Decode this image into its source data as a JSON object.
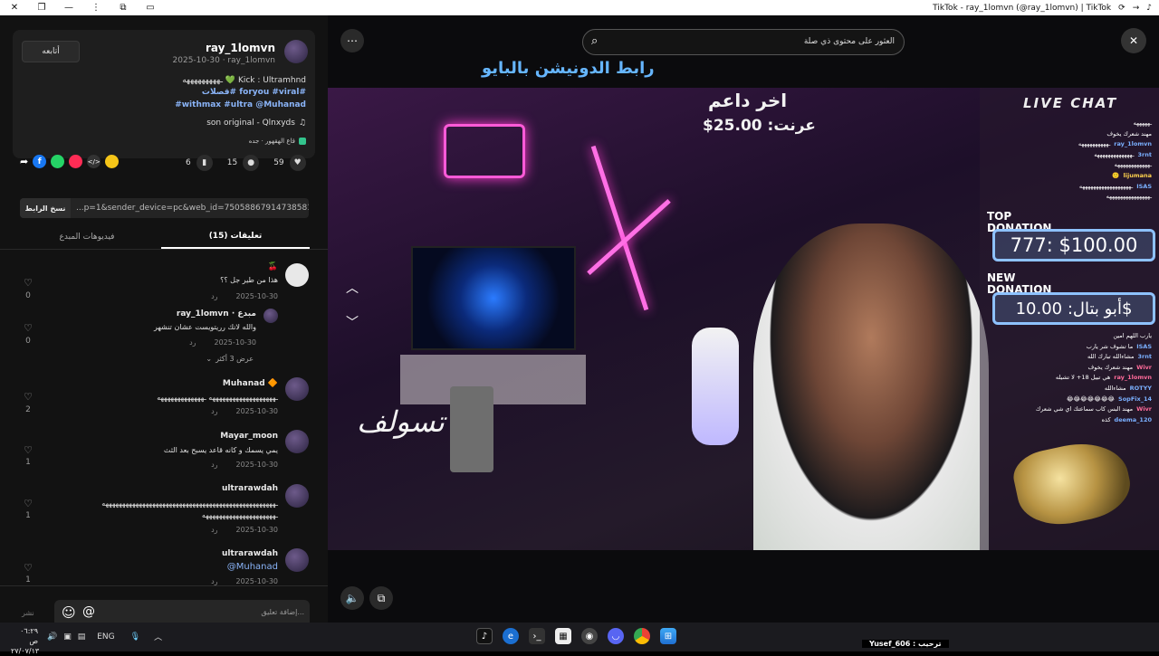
{
  "window": {
    "title": "TikTok - ray_1lomvn (@ray_1lomvn) | TikTok"
  },
  "post": {
    "username": "ray_1lomvn",
    "meta": "2025-10-30 · ray_1lomvn",
    "follow_label": "أتابعه",
    "caption_line1": "Kick : Ultramhnd 💚 ـهههههههههه",
    "hashtags_line1": "#foryou #viral #قصلات",
    "hashtags_line2": "#withmax #ultra @Muhanad",
    "music": "son original - Qlnxyds",
    "tag_text": "قاع الهقهور · جده",
    "likes": "59",
    "comments": "15",
    "saves": "6",
    "link_value": "...p=1&sender_device=pc&web_id=7505886791473858103",
    "copy_label": "نسخ الرابط"
  },
  "tabs": {
    "comments": "(15) تعليقات",
    "creator_videos": "فيديوهات المبدع"
  },
  "comments": [
    {
      "name": "🍒",
      "text": "هذا من طير جل ؟؟",
      "date": "2025-10-30",
      "reply": "رد",
      "likes": "0"
    },
    {
      "name": "ray_1lomvn · مبدع",
      "text": "والله لانك رريتويست عشان تنشهر",
      "date": "2025-10-30",
      "reply": "رد",
      "likes": "0",
      "more": "عرض 3 أكثر"
    },
    {
      "name": "Muhanad 🔶",
      "text": "ـهههههههههههههههههههه ـهههههههههههههه",
      "date": "2025-10-30",
      "reply": "رد",
      "likes": "2"
    },
    {
      "name": "Mayar_moon",
      "text": "يمي يسمك و كانه قاعد يسبح بعد الثث",
      "date": "2025-10-30",
      "reply": "رد",
      "likes": "1"
    },
    {
      "name": "ultrarawdah",
      "text": "ـهههههههههههههههههههههههههههههههههههههههههههههههههههه",
      "text2": "ـهههههههههههههههههههههه",
      "date": "2025-10-30",
      "reply": "رد",
      "likes": "1"
    },
    {
      "name": "ultrarawdah",
      "text": "@Muhanad",
      "date": "2025-10-30",
      "reply": "رد",
      "likes": "1"
    }
  ],
  "composer": {
    "placeholder": "إضافة تعليق...",
    "post_label": "نشر"
  },
  "search": {
    "placeholder": "العثور على محتوى ذي صلة"
  },
  "overlay": {
    "banner": "رابط الدونيشن بالبايو",
    "last_supporter_title": "اخر داعم",
    "last_supporter_amount": "عرنت: 25.00$",
    "live_chat": "LIVE CHAT",
    "top_donation_label": "TOP DONATION",
    "top_donation_value": "777: $100.00",
    "new_donation_label": "NEW DONATION",
    "new_donation_value": "أبو بتال: 10.00$",
    "signature": "تسولف"
  },
  "chat": [
    {
      "user": "",
      "msg": "ـهههههه"
    },
    {
      "user": "",
      "msg": "مهند شعرك يخوف"
    },
    {
      "user": "ray_1lomvn",
      "msg": "ـههههههههههه"
    },
    {
      "user": "3rnt",
      "msg": "ـهههههههههههههه"
    },
    {
      "user": "",
      "msg": "ـههههههههههههه"
    },
    {
      "user": "lijumana",
      "msg": "🙂"
    },
    {
      "user": "ISAS",
      "msg": "ـههههههههههههههههههه"
    },
    {
      "user": "",
      "msg": "ـهههههههههههههههه"
    },
    {
      "user": "",
      "msg": "يارب اللهم امين"
    },
    {
      "user": "ISAS",
      "msg": "ما تشوف شر يارب"
    },
    {
      "user": "3rnt",
      "msg": "مشاءالله تبارك الله"
    },
    {
      "user": "Wivr",
      "msg": "مهند شعرك يخوف"
    },
    {
      "user": "ray_1lomvn",
      "msg": "هي تبيل 18+ لا تشيله"
    },
    {
      "user": "ROTYY",
      "msg": "مشاءالله"
    },
    {
      "user": "SopFix_14",
      "msg": "😂😂😂😂😂😂😂"
    },
    {
      "user": "Wivr",
      "msg": "مهند البس كاب سماعتك اي شي شعرك"
    },
    {
      "user": "deema_120",
      "msg": "كذه"
    }
  ],
  "taskbar": {
    "time": "٠٦:٢٩ ص",
    "date": "٢٧/٠٧/١٣",
    "lang": "ENG",
    "notification": "Yusef_606 : ترحيب"
  },
  "colors": {
    "accent": "#fe2c55",
    "link": "#8ab4f8",
    "panel": "#121212"
  }
}
